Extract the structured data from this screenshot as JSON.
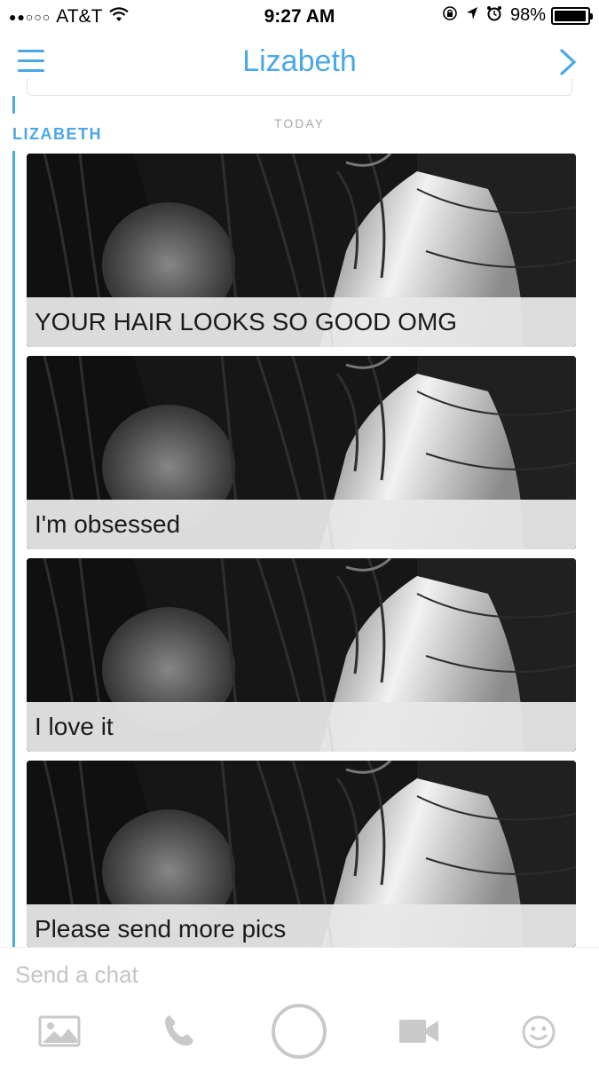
{
  "status_bar": {
    "carrier": "AT&T",
    "signal": "●●○○○",
    "time": "9:27 AM",
    "battery_percent": "98%",
    "battery_level": 0.98
  },
  "header": {
    "title": "Lizabeth"
  },
  "chat": {
    "day_label": "TODAY",
    "sender": "LIZABETH",
    "messages": [
      {
        "caption": "YOUR HAIR LOOKS SO GOOD OMG"
      },
      {
        "caption": "I'm obsessed"
      },
      {
        "caption": "I love it"
      },
      {
        "caption": "Please send more pics"
      }
    ]
  },
  "input": {
    "placeholder": "Send a chat"
  },
  "toolbar": {
    "icons": [
      "photo-icon",
      "phone-icon",
      "camera-capture-icon",
      "video-icon",
      "emoji-icon"
    ]
  },
  "colors": {
    "accent": "#4aa8e8",
    "icon_gray": "#c9c9c9"
  }
}
